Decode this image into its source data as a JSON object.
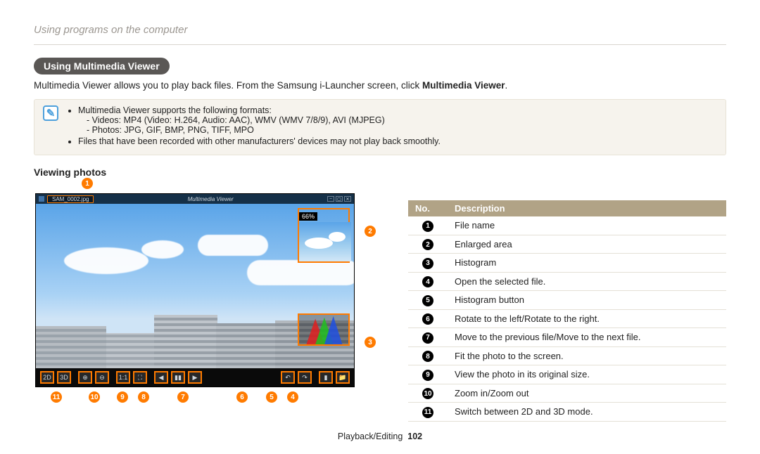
{
  "breadcrumb": "Using programs on the computer",
  "section_title": "Using Multimedia Viewer",
  "lead_pre": "Multimedia Viewer allows you to play back files. From the Samsung i-Launcher screen, click ",
  "lead_bold": "Multimedia Viewer",
  "lead_post": ".",
  "note": {
    "line1": "Multimedia Viewer supports the following formats:",
    "sub1": "Videos: MP4 (Video: H.264, Audio: AAC), WMV (WMV 7/8/9), AVI (MJPEG)",
    "sub2": "Photos: JPG, GIF, BMP, PNG, TIFF, MPO",
    "line2": "Files that have been recorded with other manufacturers' devices may not play back smoothly."
  },
  "subhead": "Viewing photos",
  "shot": {
    "file_name": "SAM_0002.jpg",
    "app_title": "Multimedia Viewer",
    "zoom_pct": "66%",
    "buttons": {
      "b2d": "2D",
      "b3d": "3D",
      "bzoomin": "⊕",
      "bzoomout": "⊖",
      "b11": "1:1",
      "bfit": "⛶",
      "bprev": "◀",
      "bnext": "▶",
      "bpause": "▮▮",
      "brotl": "↶",
      "brotr": "↷",
      "bhist": "▮",
      "bopen": "📁"
    }
  },
  "callouts": {
    "c1": "1",
    "c2": "2",
    "c3": "3",
    "c4": "4",
    "c5": "5",
    "c6": "6",
    "c7": "7",
    "c8": "8",
    "c9": "9",
    "c10": "10",
    "c11": "11"
  },
  "table": {
    "h_no": "No.",
    "h_desc": "Description",
    "rows": [
      {
        "n": "1",
        "d": "File name"
      },
      {
        "n": "2",
        "d": "Enlarged area"
      },
      {
        "n": "3",
        "d": "Histogram"
      },
      {
        "n": "4",
        "d": "Open the selected file."
      },
      {
        "n": "5",
        "d": "Histogram button"
      },
      {
        "n": "6",
        "d": "Rotate to the left/Rotate to the right."
      },
      {
        "n": "7",
        "d": "Move to the previous file/Move to the next file."
      },
      {
        "n": "8",
        "d": "Fit the photo to the screen."
      },
      {
        "n": "9",
        "d": "View the photo in its original size."
      },
      {
        "n": "10",
        "d": "Zoom in/Zoom out"
      },
      {
        "n": "11",
        "d": "Switch between 2D and 3D mode."
      }
    ]
  },
  "footer": {
    "section": "Playback/Editing",
    "page": "102"
  }
}
